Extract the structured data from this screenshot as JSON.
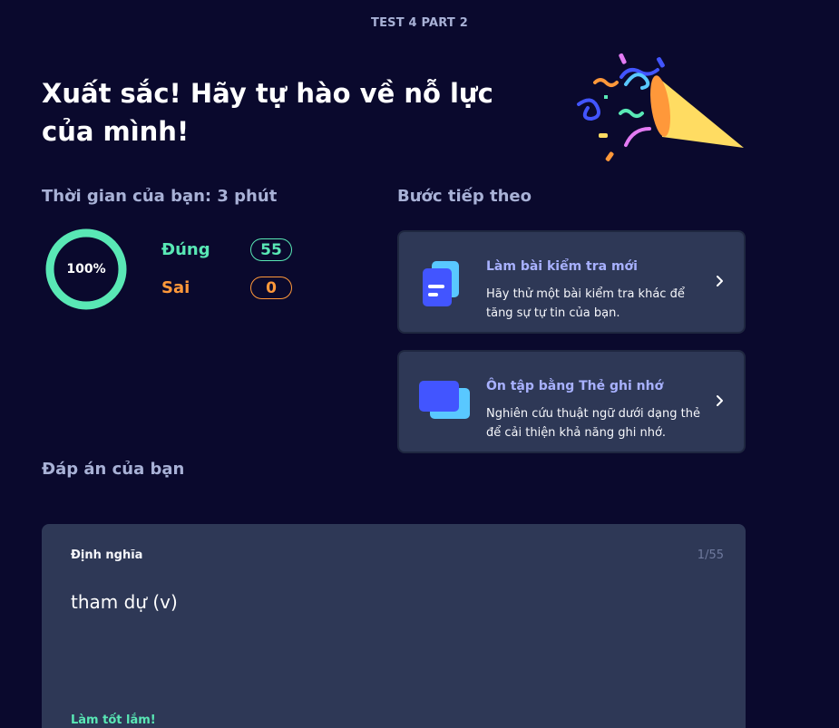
{
  "header": {
    "test_title": "TEST 4 PART 2"
  },
  "headline": "Xuất sắc! Hãy tự hào về nỗ lực của mình!",
  "results": {
    "time_label": "Thời gian của bạn: 3 phút",
    "percent_text": "100%",
    "percent_value": 100,
    "correct_label": "Đúng",
    "correct_count": "55",
    "wrong_label": "Sai",
    "wrong_count": "0"
  },
  "next_steps": {
    "label": "Bước tiếp theo",
    "cards": [
      {
        "title": "Làm bài kiểm tra mới",
        "description": "Hãy thử một bài kiểm tra khác để tăng sự tự tin của bạn.",
        "icon": "test-document-icon"
      },
      {
        "title": "Ôn tập bằng Thẻ ghi nhớ",
        "description": "Nghiên cứu thuật ngữ dưới dạng thẻ để cải thiện khả năng ghi nhớ.",
        "icon": "flashcards-icon"
      }
    ]
  },
  "answers": {
    "label": "Đáp án của bạn",
    "card": {
      "label": "Định nghĩa",
      "counter": "1/55",
      "term": "tham dự (v)",
      "feedback": "Làm tốt lắm!"
    }
  },
  "colors": {
    "background": "#0a092d",
    "card": "#2e3856",
    "correct": "#59e8b5",
    "wrong": "#ff983a",
    "accent": "#a8b1ff"
  }
}
